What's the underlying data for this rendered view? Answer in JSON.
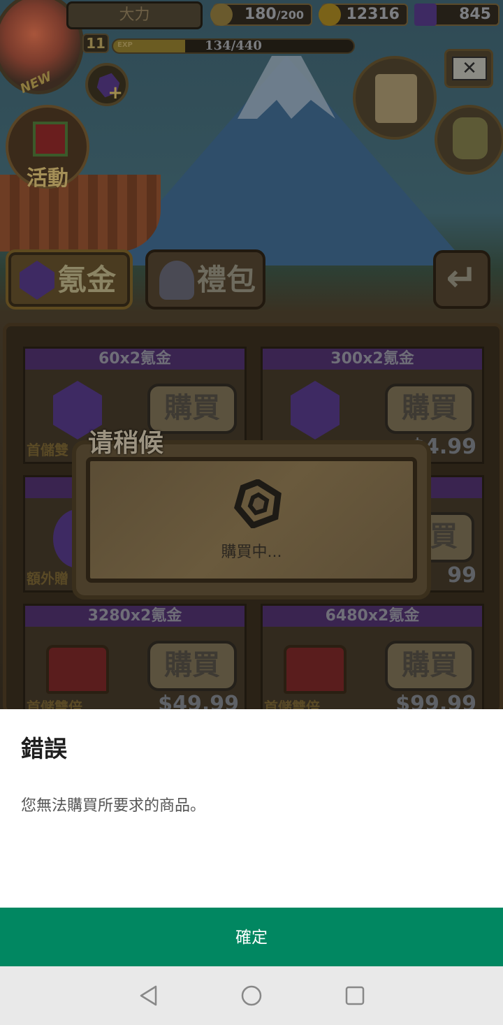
{
  "game": {
    "player_name": "大力",
    "new_badge": "NEW",
    "stamina": {
      "current": "180",
      "max": "/200"
    },
    "gold": "12316",
    "gems": "845",
    "level": "11",
    "exp": {
      "label": "EXP",
      "text": "134/440",
      "fraction": 0.3
    },
    "event_label": "活動",
    "tabs": [
      {
        "label": "氪金",
        "active": true
      },
      {
        "label": "禮包",
        "active": false
      }
    ],
    "back_icon": "back-arrow-icon"
  },
  "shop": {
    "cards": [
      {
        "title": "60x2氪金",
        "buy": "購買",
        "price": "",
        "bonus": "首儲雙",
        "image": "gem"
      },
      {
        "title": "300x2氪金",
        "buy": "購買",
        "price": "$4.99",
        "bonus": "",
        "image": "gem"
      },
      {
        "title": "",
        "buy": "購買",
        "price": "",
        "bonus": "額外贈",
        "image": "bag"
      },
      {
        "title": "",
        "buy": "購買",
        "price": "99",
        "bonus": "",
        "image": "gem"
      },
      {
        "title": "3280x2氪金",
        "buy": "購買",
        "price": "$49.99",
        "bonus": "首儲雙倍",
        "image": "chest"
      },
      {
        "title": "6480x2氪金",
        "buy": "購買",
        "price": "$99.99",
        "bonus": "首儲雙倍",
        "image": "chest"
      }
    ]
  },
  "wait_dialog": {
    "title": "请稍候",
    "message": "購買中..."
  },
  "error_sheet": {
    "title": "錯誤",
    "message": "您無法購買所要求的商品。",
    "ok_label": "確定"
  },
  "colors": {
    "accent": "#018761",
    "sheet_bg": "#ffffff",
    "navbar_bg": "#e9e9e9"
  },
  "navbar": {
    "icons": [
      "back-triangle-icon",
      "home-circle-icon",
      "recents-square-icon"
    ]
  }
}
